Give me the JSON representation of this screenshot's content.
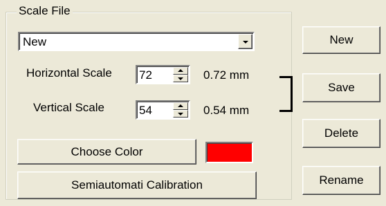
{
  "scale_file": {
    "group_title": "Scale File",
    "dropdown": {
      "selected": "New"
    },
    "horizontal": {
      "label": "Horizontal Scale",
      "value": "72",
      "mm": "0.72 mm"
    },
    "vertical": {
      "label": "Vertical Scale",
      "value": "54",
      "mm": "0.54 mm"
    },
    "choose_color_label": "Choose Color",
    "color": "#ff0000",
    "calibration_label": "Semiautomati Calibration"
  },
  "actions": {
    "new_label": "New",
    "save_label": "Save",
    "delete_label": "Delete",
    "rename_label": "Rename"
  },
  "icons": {
    "dropdown": "chevron-down-icon",
    "spin_up": "arrow-up-icon",
    "spin_down": "arrow-down-icon"
  }
}
